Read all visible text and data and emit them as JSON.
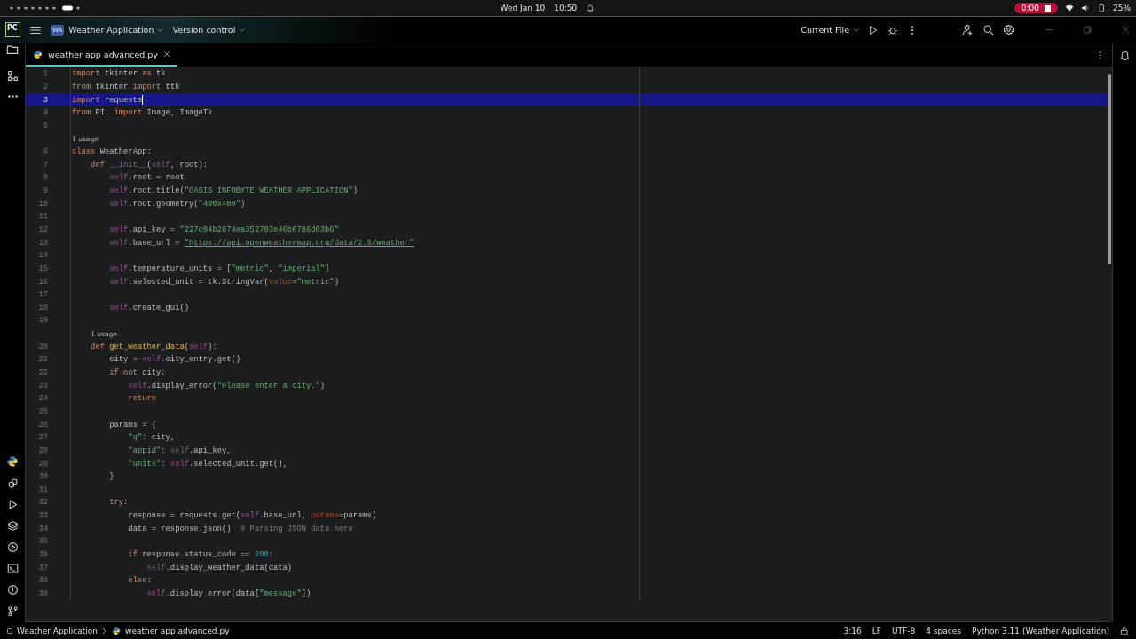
{
  "system_bar": {
    "date": "Wed Jan 10",
    "time": "10:50",
    "recording": "0:00",
    "battery": "25%"
  },
  "title_bar": {
    "logo": "PC",
    "project_badge": "WA",
    "project": "Weather Application",
    "vcs": "Version control",
    "run_config": "Current File"
  },
  "tabs": [
    {
      "label": "weather app advanced.py",
      "selected": true
    }
  ],
  "editor": {
    "rows": [
      {
        "kind": "code",
        "number": "1",
        "selected": false,
        "tokens": [
          {
            "kind": "keyword",
            "text": "import"
          },
          {
            "kind": "plain",
            "text": " tkinter "
          },
          {
            "kind": "keyword",
            "text": "as"
          },
          {
            "kind": "plain",
            "text": " tk"
          }
        ]
      },
      {
        "kind": "code",
        "number": "2",
        "selected": false,
        "tokens": [
          {
            "kind": "keyword",
            "text": "from"
          },
          {
            "kind": "plain",
            "text": " tkinter "
          },
          {
            "kind": "keyword",
            "text": "import"
          },
          {
            "kind": "plain",
            "text": " ttk"
          }
        ]
      },
      {
        "kind": "code",
        "number": "3",
        "selected": true,
        "tokens": [
          {
            "kind": "keyword",
            "text": "import"
          },
          {
            "kind": "plain",
            "text": " requests"
          }
        ]
      },
      {
        "kind": "code",
        "number": "4",
        "selected": false,
        "tokens": [
          {
            "kind": "keyword",
            "text": "from"
          },
          {
            "kind": "plain",
            "text": " PIL "
          },
          {
            "kind": "keyword",
            "text": "import"
          },
          {
            "kind": "plain",
            "text": " Image, ImageTk"
          }
        ]
      },
      {
        "kind": "code",
        "number": "5",
        "selected": false
      },
      {
        "kind": "hint",
        "text": "1 usage",
        "selected": false
      },
      {
        "kind": "code",
        "number": "6",
        "selected": false,
        "tokens": [
          {
            "kind": "keyword",
            "text": "class"
          },
          {
            "kind": "plain",
            "text": " WeatherApp:"
          }
        ]
      },
      {
        "kind": "code",
        "number": "7",
        "selected": false,
        "tokens": [
          {
            "kind": "keyword",
            "text": "    def "
          },
          {
            "kind": "dunder",
            "text": "__init__"
          },
          {
            "kind": "plain",
            "text": "("
          },
          {
            "kind": "self",
            "text": "self"
          },
          {
            "kind": "plain",
            "text": ", root):"
          }
        ]
      },
      {
        "kind": "code",
        "number": "8",
        "selected": false,
        "tokens": [
          {
            "kind": "self",
            "text": "        self"
          },
          {
            "kind": "plain",
            "text": ".root = root"
          }
        ]
      },
      {
        "kind": "code",
        "number": "9",
        "selected": false,
        "tokens": [
          {
            "kind": "self",
            "text": "        self"
          },
          {
            "kind": "plain",
            "text": ".root.title("
          },
          {
            "kind": "string",
            "text": "\"OASIS INFOBYTE WEATHER APPLICATION\""
          },
          {
            "kind": "plain",
            "text": ")"
          }
        ]
      },
      {
        "kind": "code",
        "number": "10",
        "selected": false,
        "tokens": [
          {
            "kind": "self",
            "text": "        self"
          },
          {
            "kind": "plain",
            "text": ".root.geometry("
          },
          {
            "kind": "string",
            "text": "\"400x400\""
          },
          {
            "kind": "plain",
            "text": ")"
          }
        ]
      },
      {
        "kind": "code",
        "number": "11",
        "selected": false
      },
      {
        "kind": "code",
        "number": "12",
        "selected": false,
        "tokens": [
          {
            "kind": "self",
            "text": "        self"
          },
          {
            "kind": "plain",
            "text": ".api_key = "
          },
          {
            "kind": "string",
            "text": "\"227c04b2874ea352703e46b0786d03b6\""
          }
        ]
      },
      {
        "kind": "code",
        "number": "13",
        "selected": false,
        "tokens": [
          {
            "kind": "self",
            "text": "        self"
          },
          {
            "kind": "plain",
            "text": ".base_url = "
          },
          {
            "kind": "url",
            "text": "\"https://api.openweathermap.org/data/2.5/weather\""
          }
        ]
      },
      {
        "kind": "code",
        "number": "14",
        "selected": false
      },
      {
        "kind": "code",
        "number": "15",
        "selected": false,
        "tokens": [
          {
            "kind": "self",
            "text": "        self"
          },
          {
            "kind": "plain",
            "text": ".temperature_units = ["
          },
          {
            "kind": "string",
            "text": "\"metric\""
          },
          {
            "kind": "plain",
            "text": ", "
          },
          {
            "kind": "string",
            "text": "\"imperial\""
          },
          {
            "kind": "plain",
            "text": "]"
          }
        ]
      },
      {
        "kind": "code",
        "number": "16",
        "selected": false,
        "tokens": [
          {
            "kind": "self",
            "text": "        self"
          },
          {
            "kind": "plain",
            "text": ".selected_unit = tk.StringVar("
          },
          {
            "kind": "param",
            "text": "value"
          },
          {
            "kind": "plain",
            "text": "="
          },
          {
            "kind": "string",
            "text": "\"metric\""
          },
          {
            "kind": "plain",
            "text": ")"
          }
        ]
      },
      {
        "kind": "code",
        "number": "17",
        "selected": false
      },
      {
        "kind": "code",
        "number": "18",
        "selected": false,
        "tokens": [
          {
            "kind": "self",
            "text": "        self"
          },
          {
            "kind": "plain",
            "text": ".create_gui()"
          }
        ]
      },
      {
        "kind": "code",
        "number": "19",
        "selected": false
      },
      {
        "kind": "hint",
        "text": "1 usage",
        "selected": false
      },
      {
        "kind": "code",
        "number": "20",
        "selected": false,
        "tokens": [
          {
            "kind": "keyword",
            "text": "    def "
          },
          {
            "kind": "function",
            "text": "get_weather_data"
          },
          {
            "kind": "plain",
            "text": "("
          },
          {
            "kind": "self",
            "text": "self"
          },
          {
            "kind": "plain",
            "text": "):"
          }
        ]
      },
      {
        "kind": "code",
        "number": "21",
        "selected": false,
        "tokens": [
          {
            "kind": "plain",
            "text": "        city = "
          },
          {
            "kind": "self",
            "text": "self"
          },
          {
            "kind": "plain",
            "text": ".city_entry.get()"
          }
        ]
      },
      {
        "kind": "code",
        "number": "22",
        "selected": false,
        "tokens": [
          {
            "kind": "keyword",
            "text": "        if not"
          },
          {
            "kind": "plain",
            "text": " city:"
          }
        ]
      },
      {
        "kind": "code",
        "number": "23",
        "selected": false,
        "tokens": [
          {
            "kind": "self",
            "text": "            self"
          },
          {
            "kind": "plain",
            "text": ".display_error("
          },
          {
            "kind": "string",
            "text": "\"Please enter a city.\""
          },
          {
            "kind": "plain",
            "text": ")"
          }
        ]
      },
      {
        "kind": "code",
        "number": "24",
        "selected": false,
        "tokens": [
          {
            "kind": "keyword",
            "text": "            return"
          }
        ]
      },
      {
        "kind": "code",
        "number": "25",
        "selected": false
      },
      {
        "kind": "code",
        "number": "26",
        "selected": false,
        "tokens": [
          {
            "kind": "plain",
            "text": "        params = {"
          }
        ]
      },
      {
        "kind": "code",
        "number": "27",
        "selected": false,
        "tokens": [
          {
            "kind": "string",
            "text": "            \"q\""
          },
          {
            "kind": "plain",
            "text": ": city,"
          }
        ]
      },
      {
        "kind": "code",
        "number": "28",
        "selected": false,
        "tokens": [
          {
            "kind": "string",
            "text": "            \"appid\""
          },
          {
            "kind": "plain",
            "text": ": "
          },
          {
            "kind": "self",
            "text": "self"
          },
          {
            "kind": "plain",
            "text": ".api_key,"
          }
        ]
      },
      {
        "kind": "code",
        "number": "29",
        "selected": false,
        "tokens": [
          {
            "kind": "string",
            "text": "            \"units\""
          },
          {
            "kind": "plain",
            "text": ": "
          },
          {
            "kind": "self",
            "text": "self"
          },
          {
            "kind": "plain",
            "text": ".selected_unit.get(),"
          }
        ]
      },
      {
        "kind": "code",
        "number": "30",
        "selected": false,
        "tokens": [
          {
            "kind": "plain",
            "text": "        }"
          }
        ]
      },
      {
        "kind": "code",
        "number": "31",
        "selected": false
      },
      {
        "kind": "code",
        "number": "32",
        "selected": false,
        "tokens": [
          {
            "kind": "keyword",
            "text": "        try"
          },
          {
            "kind": "plain",
            "text": ":"
          }
        ]
      },
      {
        "kind": "code",
        "number": "33",
        "selected": false,
        "tokens": [
          {
            "kind": "plain",
            "text": "            response = requests.get("
          },
          {
            "kind": "self",
            "text": "self"
          },
          {
            "kind": "plain",
            "text": ".base_url, "
          },
          {
            "kind": "param",
            "text": "params"
          },
          {
            "kind": "plain",
            "text": "=params)"
          }
        ]
      },
      {
        "kind": "code",
        "number": "34",
        "selected": false,
        "tokens": [
          {
            "kind": "plain",
            "text": "            data = response.json()  "
          },
          {
            "kind": "comment",
            "text": "# Parsing JSON data here"
          }
        ]
      },
      {
        "kind": "code",
        "number": "35",
        "selected": false
      },
      {
        "kind": "code",
        "number": "36",
        "selected": false,
        "tokens": [
          {
            "kind": "keyword",
            "text": "            if"
          },
          {
            "kind": "plain",
            "text": " response.status_code == "
          },
          {
            "kind": "number",
            "text": "200"
          },
          {
            "kind": "plain",
            "text": ":"
          }
        ]
      },
      {
        "kind": "code",
        "number": "37",
        "selected": false,
        "tokens": [
          {
            "kind": "self",
            "text": "                self"
          },
          {
            "kind": "plain",
            "text": ".display_weather_data(data)"
          }
        ]
      },
      {
        "kind": "code",
        "number": "38",
        "selected": false,
        "tokens": [
          {
            "kind": "keyword",
            "text": "            else"
          },
          {
            "kind": "plain",
            "text": ":"
          }
        ]
      },
      {
        "kind": "code",
        "number": "39",
        "selected": false,
        "tokens": [
          {
            "kind": "self",
            "text": "                self"
          },
          {
            "kind": "plain",
            "text": ".display_error(data["
          },
          {
            "kind": "string",
            "text": "\"message\""
          },
          {
            "kind": "plain",
            "text": "])"
          }
        ]
      }
    ]
  },
  "status_bar": {
    "breadcrumbs": [
      "Weather Application",
      "weather app advanced.py"
    ],
    "position": "3:16",
    "line_separator": "LF",
    "encoding": "UTF-8",
    "indent": "4 spaces",
    "interpreter": "Python 3.11 (Weather Application)"
  }
}
